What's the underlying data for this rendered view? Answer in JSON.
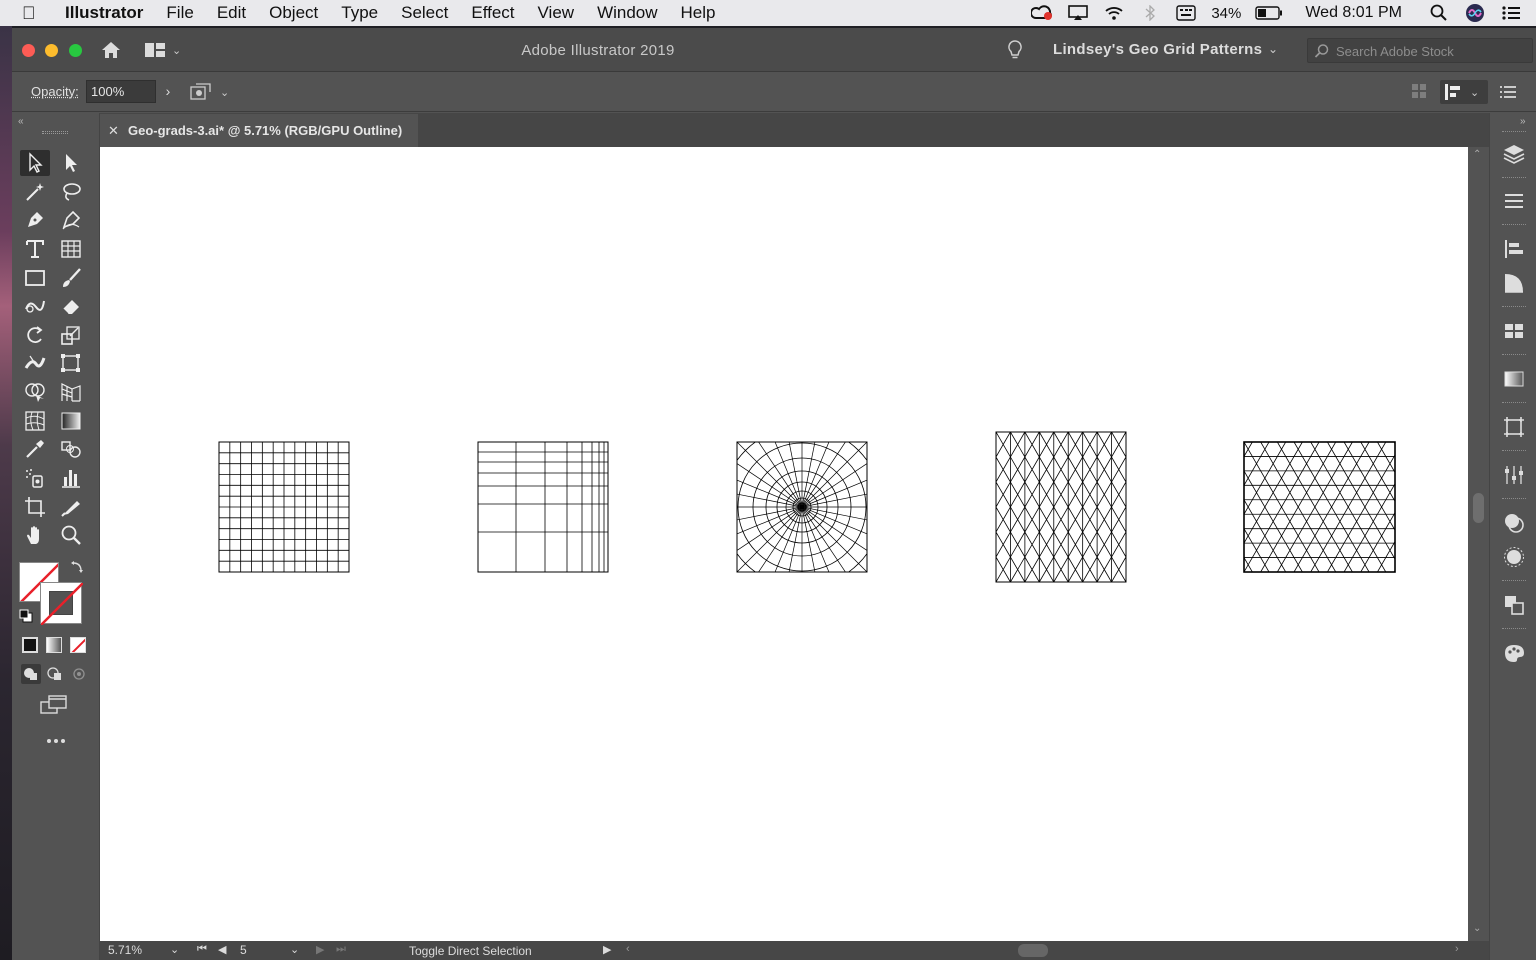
{
  "menubar": {
    "apple_icon": "apple-icon",
    "app_name": "Illustrator",
    "items": [
      "File",
      "Edit",
      "Object",
      "Type",
      "Select",
      "Effect",
      "View",
      "Window",
      "Help"
    ],
    "battery_percent": "34%",
    "clock": "Wed 8:01 PM"
  },
  "titlebar": {
    "title": "Adobe Illustrator 2019",
    "workspace": "Lindsey's Geo Grid Patterns",
    "stock_search_placeholder": "Search Adobe Stock"
  },
  "controlbar": {
    "opacity_label": "Opacity:",
    "opacity_value": "100%"
  },
  "document": {
    "tab_title": "Geo-grads-3.ai* @ 5.71% (RGB/GPU Outline)",
    "artworks": [
      {
        "name": "square-grid",
        "kind": "square grid"
      },
      {
        "name": "perspective-grid",
        "kind": "progressive grid"
      },
      {
        "name": "polar-grid",
        "kind": "polar grid"
      },
      {
        "name": "isometric-grid",
        "kind": "isometric grid"
      },
      {
        "name": "triangle-grid",
        "kind": "triangle grid"
      }
    ]
  },
  "statusbar": {
    "zoom": "5.71%",
    "artboard": "5",
    "status_text": "Toggle Direct Selection"
  },
  "colors": {
    "ui_dark": "#535353",
    "canvas": "#ffffff",
    "close": "#fd5c55",
    "minimize": "#fdbc2d",
    "maximize": "#28c840"
  }
}
